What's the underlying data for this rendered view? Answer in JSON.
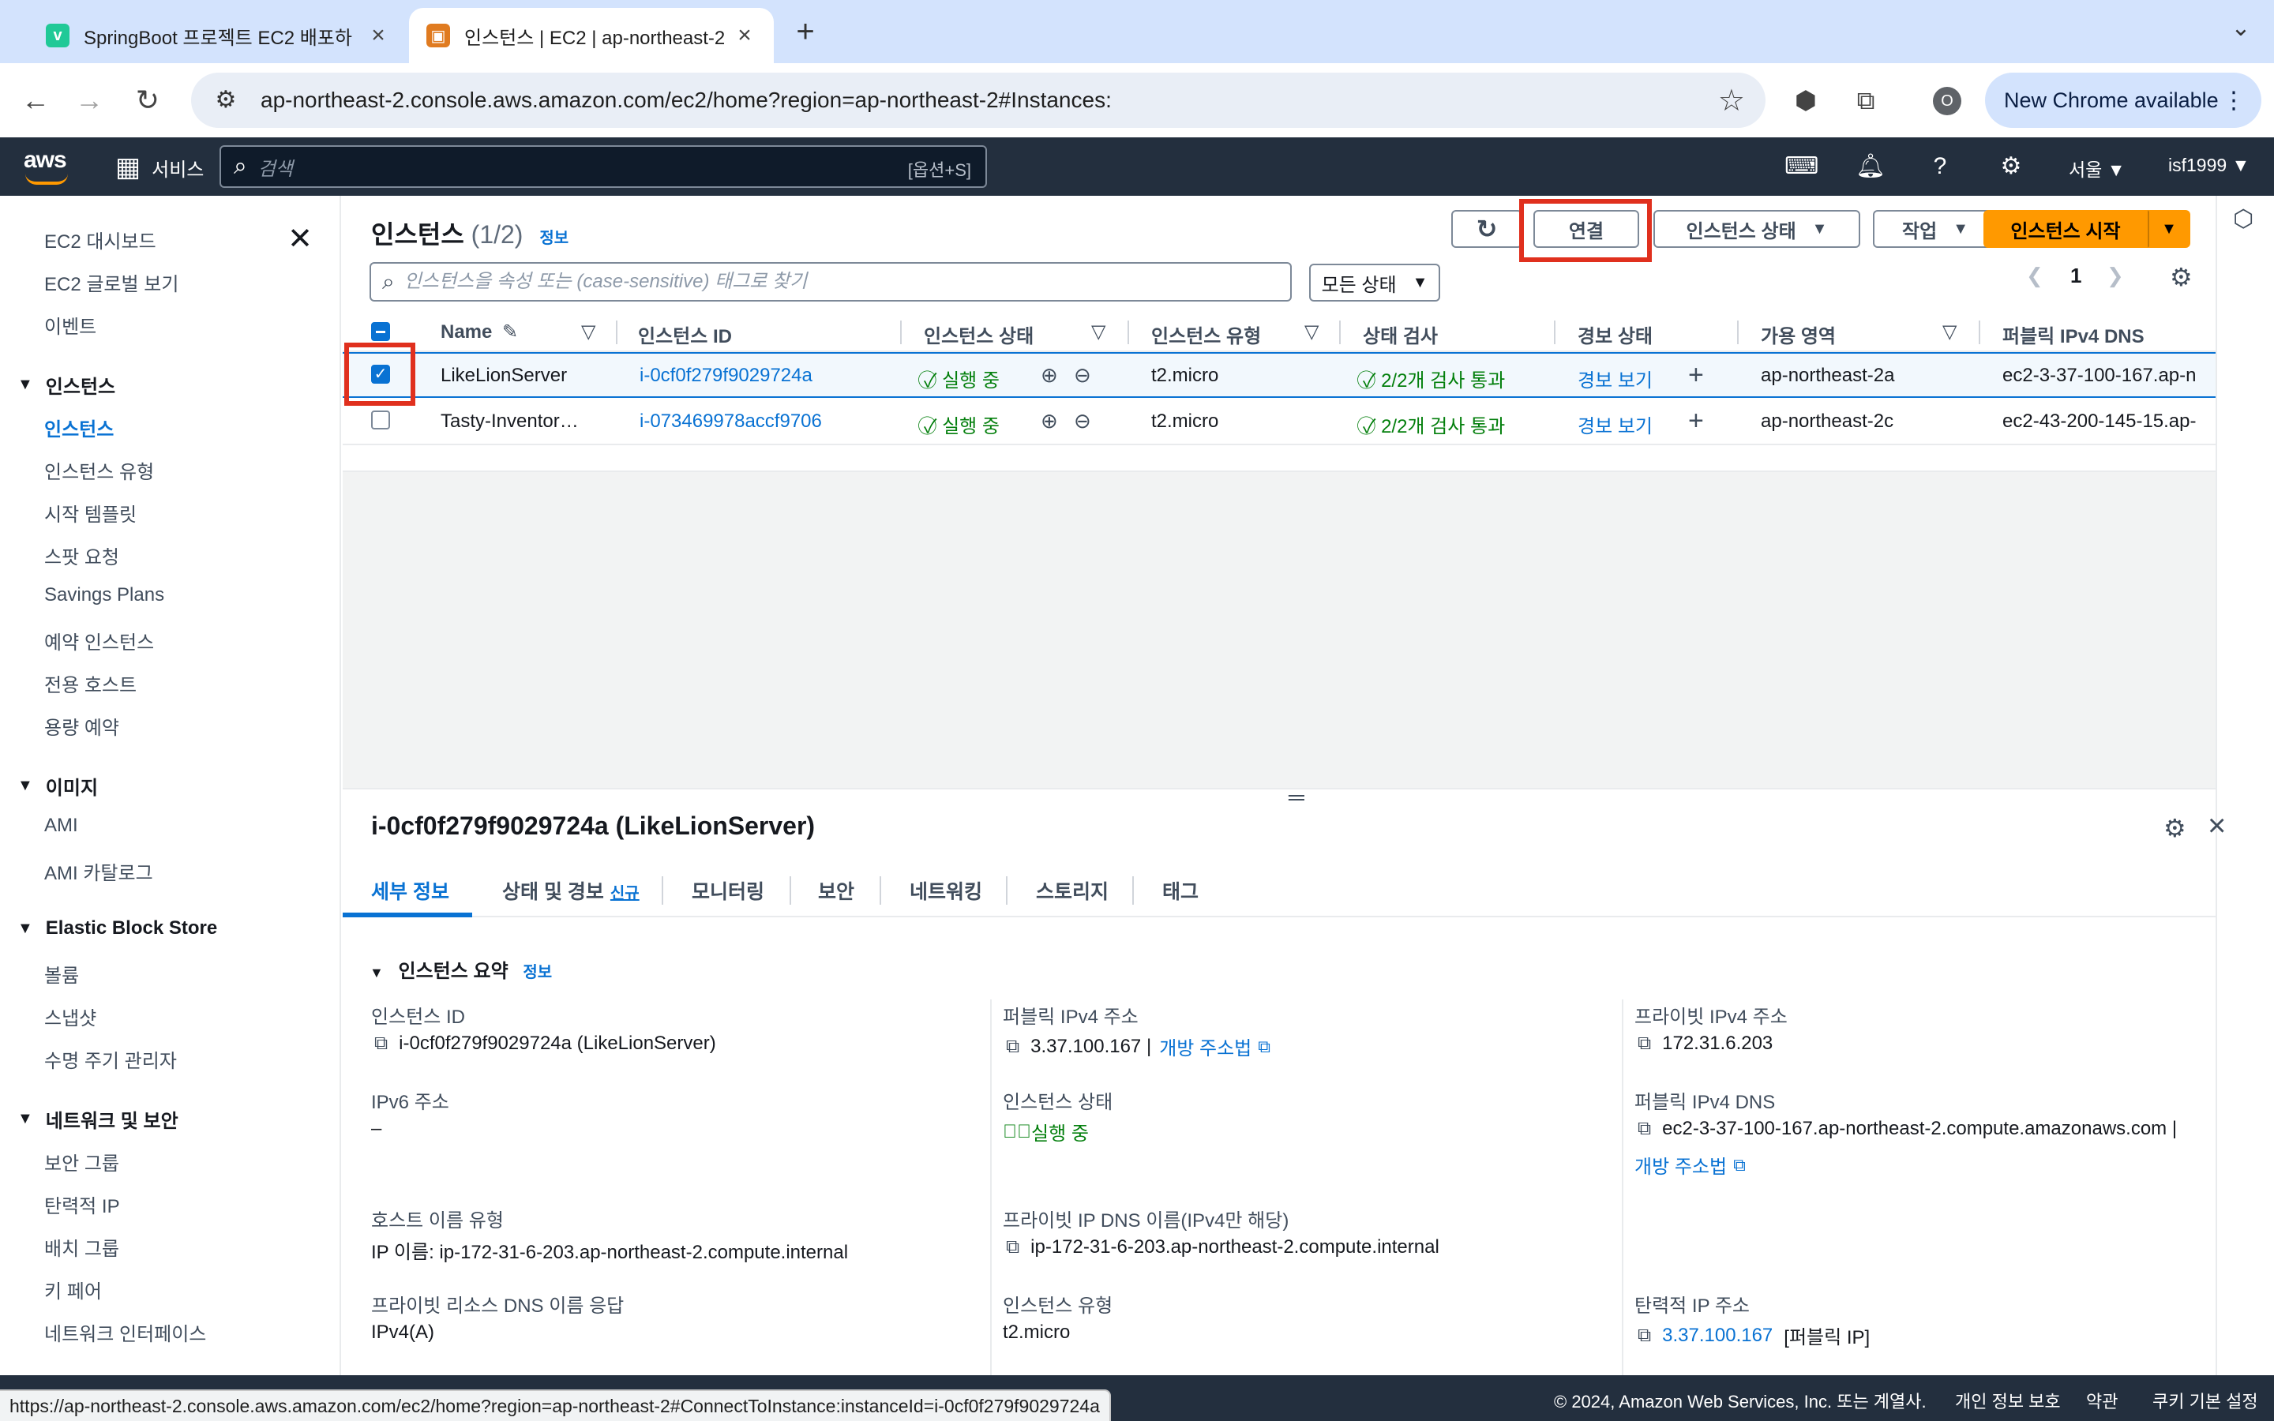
{
  "browser": {
    "tabs": [
      {
        "title": "SpringBoot 프로젝트 EC2 배포하",
        "favicon": "v"
      },
      {
        "title": "인스턴스 | EC2 | ap-northeast-2",
        "favicon": "aws"
      }
    ],
    "url": "ap-northeast-2.console.aws.amazon.com/ec2/home?region=ap-northeast-2#Instances:",
    "new_chrome_label": "New Chrome available",
    "profile_initial": "O"
  },
  "aws_header": {
    "logo": "aws",
    "services_label": "서비스",
    "search_placeholder": "검색",
    "search_shortcut": "[옵션+S]",
    "region": "서울 ▼",
    "user": "isf1999 ▼"
  },
  "sidebar": {
    "top_links": [
      "EC2 대시보드",
      "EC2 글로벌 보기",
      "이벤트"
    ],
    "sections": [
      {
        "title": "인스턴스",
        "items": [
          "인스턴스",
          "인스턴스 유형",
          "시작 템플릿",
          "스팟 요청",
          "Savings Plans",
          "예약 인스턴스",
          "전용 호스트",
          "용량 예약"
        ]
      },
      {
        "title": "이미지",
        "items": [
          "AMI",
          "AMI 카탈로그"
        ]
      },
      {
        "title": "Elastic Block Store",
        "items": [
          "볼륨",
          "스냅샷",
          "수명 주기 관리자"
        ]
      },
      {
        "title": "네트워크 및 보안",
        "items": [
          "보안 그룹",
          "탄력적 IP",
          "배치 그룹",
          "키 페어",
          "네트워크 인터페이스"
        ]
      }
    ],
    "active_item": "인스턴스"
  },
  "instances_panel": {
    "title": "인스턴스",
    "count": "(1/2)",
    "info_label": "정보",
    "buttons": {
      "connect": "연결",
      "instance_state": "인스턴스 상태",
      "actions": "작업",
      "launch": "인스턴스 시작"
    },
    "filter_placeholder": "인스턴스을 속성 또는 (case-sensitive) 태그로 찾기",
    "state_filter": "모든 상태",
    "page_number": "1",
    "columns": [
      "Name",
      "인스턴스 ID",
      "인스턴스 상태",
      "인스턴스 유형",
      "상태 검사",
      "경보 상태",
      "가용 영역",
      "퍼블릭 IPv4 DNS"
    ],
    "rows": [
      {
        "selected": true,
        "name": "LikeLionServer",
        "id": "i-0cf0f279f9029724a",
        "state": "실행 중",
        "type": "t2.micro",
        "check": "2/2개 검사 통과",
        "alarm": "경보 보기",
        "az": "ap-northeast-2a",
        "dns": "ec2-3-37-100-167.ap-n"
      },
      {
        "selected": false,
        "name": "Tasty-Inventor…",
        "id": "i-073469978accf9706",
        "state": "실행 중",
        "type": "t2.micro",
        "check": "2/2개 검사 통과",
        "alarm": "경보 보기",
        "az": "ap-northeast-2c",
        "dns": "ec2-43-200-145-15.ap-"
      }
    ]
  },
  "details": {
    "title": "i-0cf0f279f9029724a (LikeLionServer)",
    "tabs": [
      "세부 정보",
      "상태 및 경보",
      "모니터링",
      "보안",
      "네트워킹",
      "스토리지",
      "태그"
    ],
    "new_badge": "신규",
    "summary_title": "인스턴스 요약",
    "summary_info": "정보",
    "fields": {
      "instance_id_label": "인스턴스 ID",
      "instance_id_value": "i-0cf0f279f9029724a (LikeLionServer)",
      "ipv6_label": "IPv6 주소",
      "ipv6_value": "–",
      "hostname_type_label": "호스트 이름 유형",
      "hostname_type_value": "IP 이름: ip-172-31-6-203.ap-northeast-2.compute.internal",
      "private_dns_resp_label": "프라이빗 리소스 DNS 이름 응답",
      "private_dns_resp_value": "IPv4(A)",
      "public_ipv4_label": "퍼블릭 IPv4 주소",
      "public_ipv4_value": "3.37.100.167 |",
      "open_address": "개방 주소법",
      "instance_state_label": "인스턴스 상태",
      "instance_state_value": "실행 중",
      "private_ip_dns_label": "프라이빗 IP DNS 이름(IPv4만 해당)",
      "private_ip_dns_value": "ip-172-31-6-203.ap-northeast-2.compute.internal",
      "instance_type_label": "인스턴스 유형",
      "instance_type_value": "t2.micro",
      "private_ipv4_label": "프라이빗 IPv4 주소",
      "private_ipv4_value": "172.31.6.203",
      "public_dns_label": "퍼블릭 IPv4 DNS",
      "public_dns_value": "ec2-3-37-100-167.ap-northeast-2.compute.amazonaws.com |",
      "open_address_2": "개방 주소법",
      "elastic_ip_label": "탄력적 IP 주소",
      "elastic_ip_value": "3.37.100.167",
      "elastic_ip_suffix": "[퍼블릭 IP]"
    }
  },
  "footer": {
    "copyright": "© 2024, Amazon Web Services, Inc. 또는 계열사.",
    "privacy": "개인 정보 보호",
    "terms": "약관",
    "cookies": "쿠키 기본 설정"
  },
  "status_bar_url": "https://ap-northeast-2.console.aws.amazon.com/ec2/home?region=ap-northeast-2#ConnectToInstance:instanceId=i-0cf0f279f9029724a",
  "colors": {
    "aws_nav": "#232f3e",
    "aws_orange": "#ff9900",
    "link_blue": "#0972d3",
    "success_green": "#037f0c",
    "highlight_red": "#e0301e"
  }
}
